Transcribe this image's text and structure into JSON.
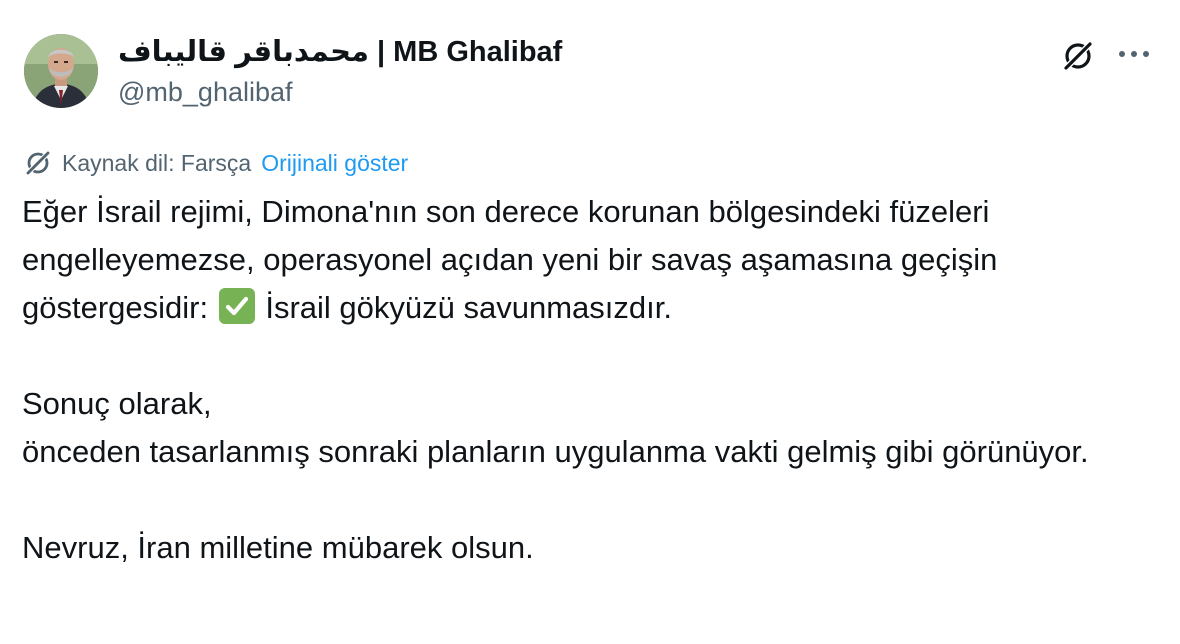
{
  "author": {
    "display_name": "محمدباقر قالیباف | MB Ghalibaf",
    "handle": "@mb_ghalibaf"
  },
  "translation": {
    "source_language": "Kaynak dil: Farsça",
    "show_original": "Orijinali göster"
  },
  "tweet": {
    "para1_before": "Eğer İsrail rejimi, Dimona'nın son derece korunan bölgesindeki füzeleri engelleyemezse, operasyonel açıdan yeni bir savaş aşamasına geçişin göstergesidir:",
    "para1_after": "İsrail gökyüzü savunmasızdır.",
    "para2_line1": "Sonuç olarak,",
    "para2_line2": "önceden tasarlanmış sonraki planların uygulanma vakti gelmiş gibi görünüyor.",
    "para3": "Nevruz, İran milletine mübarek olsun."
  },
  "icons": {
    "grok": "grok-icon",
    "more": "more-icon",
    "translate": "grok-translate-icon",
    "checkmark": "check-mark-emoji"
  },
  "colors": {
    "text_primary": "#0f1419",
    "text_secondary": "#536471",
    "link": "#1d9bf0",
    "check_green": "#77b255"
  }
}
